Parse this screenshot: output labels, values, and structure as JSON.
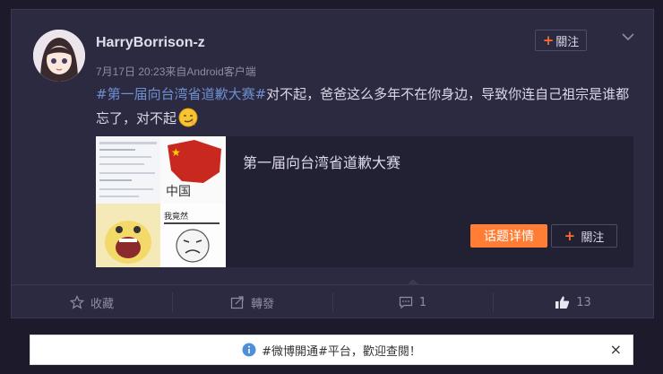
{
  "post": {
    "username": "HarryBorrison-z",
    "timestamp": "7月17日 20:23",
    "source": "来自Android客户端",
    "follow_label": "關注",
    "content_tag": "#第一届向台湾省道歉大赛#",
    "content_text": "对不起，爸爸这么多年不在你身边，导致你连自己祖宗是谁都忘了，对不起",
    "emoji": "smirk-emoji"
  },
  "topic_card": {
    "title": "第一届向台湾省道歉大赛",
    "image_caption_1": "中国",
    "image_caption_2": "我竟然",
    "detail_label": "话题详情",
    "follow_label": "關注"
  },
  "actions": {
    "favorite_label": "收藏",
    "repost_label": "轉發",
    "comment_count": "1",
    "like_count": "13"
  },
  "notice": {
    "text": "#微博開通#平台，歡迎查閱！",
    "close": "×"
  },
  "colors": {
    "background": "#1c1a2b",
    "card": "#2c2a40",
    "accent": "#ff7d35",
    "tag": "#6d8fd0"
  }
}
